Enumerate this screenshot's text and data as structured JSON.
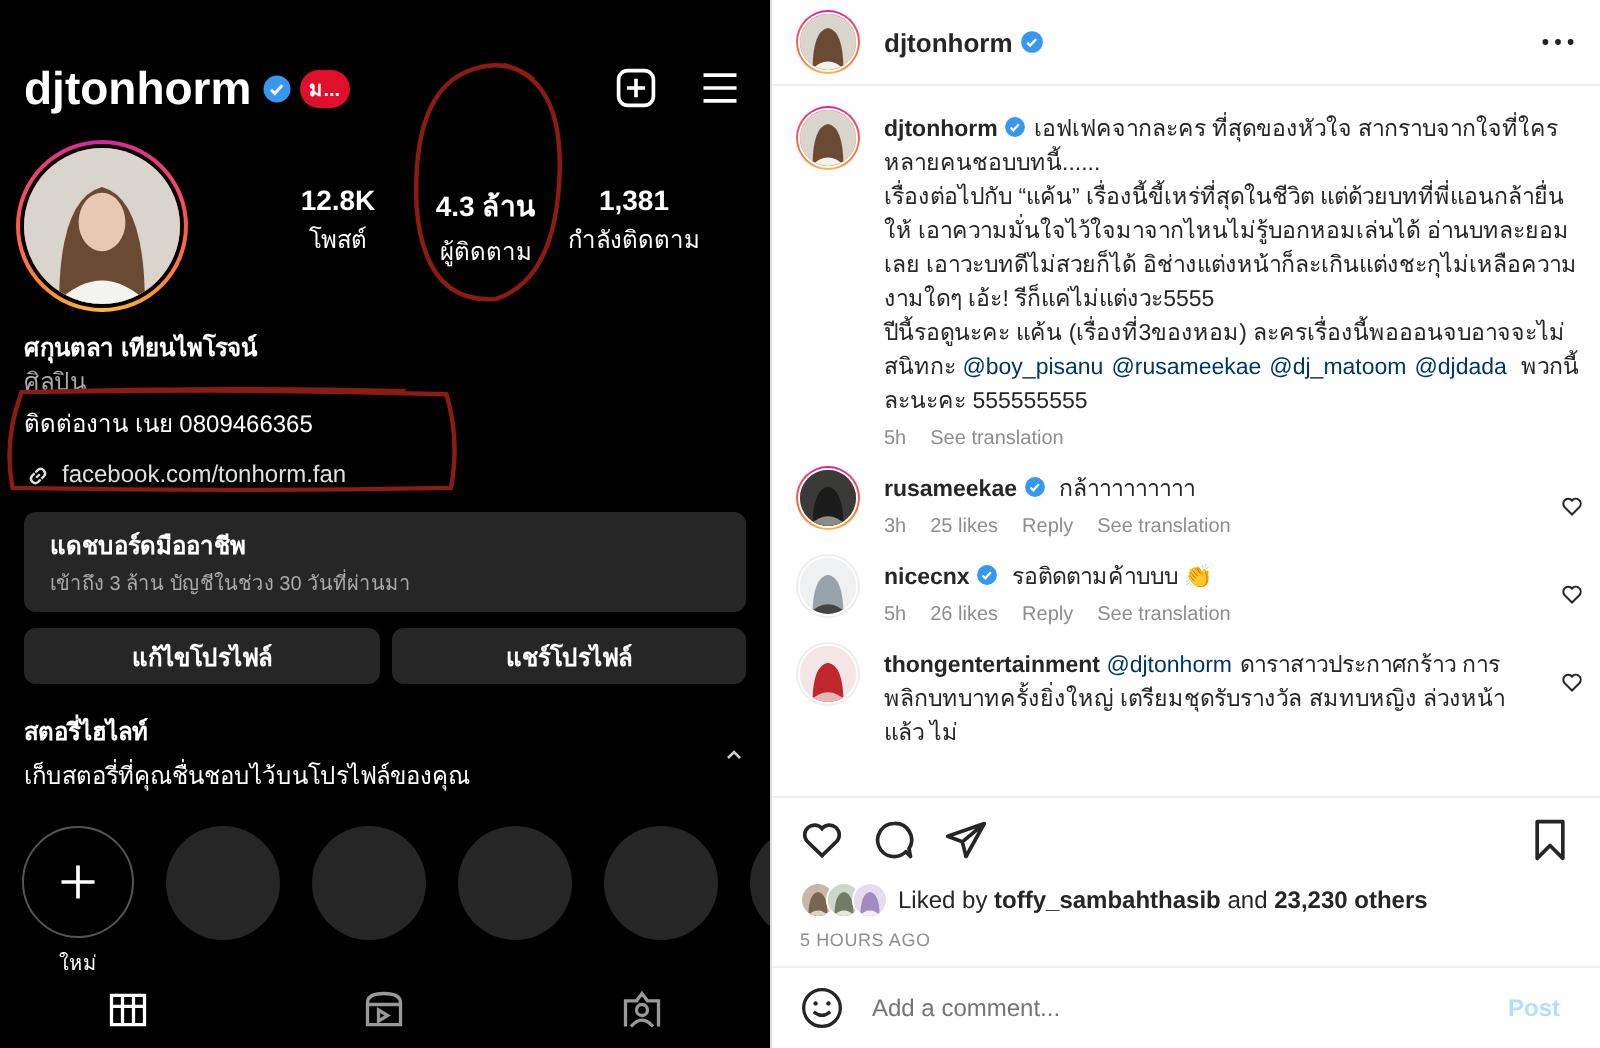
{
  "profile": {
    "username": "djtonhorm",
    "verified": true,
    "badge": "ม...",
    "stats": [
      {
        "value": "12.8K",
        "label": "โพสต์"
      },
      {
        "value": "4.3 ล้าน",
        "label": "ผู้ติดตาม"
      },
      {
        "value": "1,381",
        "label": "กำลังติดตาม"
      }
    ],
    "name": "ศกุนตลา เทียนไพโรจน์",
    "category": "ศิลปิน",
    "bio": "ติดต่องาน เนย 0809466365",
    "link": "facebook.com/tonhorm.fan",
    "dashboard": {
      "title": "แดชบอร์ดมืออาชีพ",
      "subtitle": "เข้าถึง 3 ล้าน บัญชีในช่วง 30 วันที่ผ่านมา"
    },
    "buttons": [
      "แก้ไขโปรไฟล์",
      "แชร์โปรไฟล์"
    ],
    "highlights": {
      "title": "สตอรี่ไฮไลท์",
      "subtitle": "เก็บสตอรี่ที่คุณชื่นชอบไว้บนโปรไฟล์ของคุณ",
      "expanded": true,
      "items": [
        {
          "kind": "new",
          "label": "ใหม่"
        },
        {
          "kind": "empty"
        },
        {
          "kind": "empty"
        },
        {
          "kind": "empty"
        },
        {
          "kind": "empty"
        },
        {
          "kind": "empty"
        }
      ]
    },
    "tabs": [
      {
        "kind": "grid",
        "selected": true
      },
      {
        "kind": "reels",
        "selected": false
      },
      {
        "kind": "tagged",
        "selected": false
      }
    ]
  },
  "annotations": [
    {
      "kind": "circle"
    },
    {
      "kind": "loop"
    }
  ],
  "post": {
    "username": "djtonhorm",
    "verified": true,
    "caption": [
      [
        {
          "kind": "user",
          "text": "djtonhorm"
        },
        {
          "kind": "text",
          "text": "เอฟเฟคจากละคร ที่สุดของหัวใจ สากราบจากใจที่ใครหลายคนชอบบทนี้......"
        }
      ],
      [
        {
          "kind": "text",
          "text": "เรื่องต่อไปกับ “แค้น” เรื่องนี้ขี้เหร่ที่สุดในชีวิต แต่ด้วยบทที่พี่แอนกล้ายื่นให้ เอาความมั่นใจไว้ใจมาจากไหนไม่รู้บอกหอมเล่นได้ อ่านบทละยอมเลย เอาวะบทดีไม่สวยก็ได้ อิช่างแต่งหน้าก็ละเกินแต่งชะกุไม่เหลือความงามใดๆ เอ้ะ! รีก็แค่ไม่แต่งวะ5555"
        }
      ],
      [
        {
          "kind": "text",
          "text": "ปีนี้รอดูนะคะ แค้น (เรื่องที่3ของหอม) ละครเรื่องนี้พอออนจบอาจจะไม่สนิทกะ "
        },
        {
          "kind": "mention",
          "text": "@boy_pisanu"
        },
        {
          "kind": "mention",
          "text": "@rusameekae"
        },
        {
          "kind": "mention",
          "text": "@dj_matoom"
        },
        {
          "kind": "mention",
          "text": "@djdada"
        },
        {
          "kind": "text",
          "text": " พวกนี้ละนะคะ 555555555"
        }
      ]
    ],
    "caption_meta": {
      "time": "5h",
      "translate": "See translation"
    },
    "comments": [
      {
        "username": "rusameekae",
        "verified": true,
        "text": "กล้าาาาาาาาา",
        "time": "3h",
        "likes": "25 likes",
        "reply": "Reply",
        "translate": "See translation",
        "story_ring": true
      },
      {
        "username": "nicecnx",
        "verified": true,
        "text": "รอติดตามค้าบบบ 👏",
        "time": "5h",
        "likes": "26 likes",
        "reply": "Reply",
        "translate": "See translation",
        "story_ring": false
      },
      {
        "username": "thongentertainment",
        "verified": false,
        "mention": "@djtonhorm",
        "text": "ดาราสาวประกาศกร้าว การพลิกบทบาทครั้งยิ่งใหญ่ เตรียมชุดรับรางวัล สมทบหญิง ล่วงหน้าแล้ว ไม่",
        "story_ring": false
      }
    ],
    "liked_by": "Liked by **toffy_sambahthasib** and **23,230 others**",
    "time_ago": "5 HOURS AGO",
    "comment_field": {
      "placeholder": "Add a comment..."
    },
    "post_button": {
      "label": "Post",
      "disabled": true
    }
  }
}
